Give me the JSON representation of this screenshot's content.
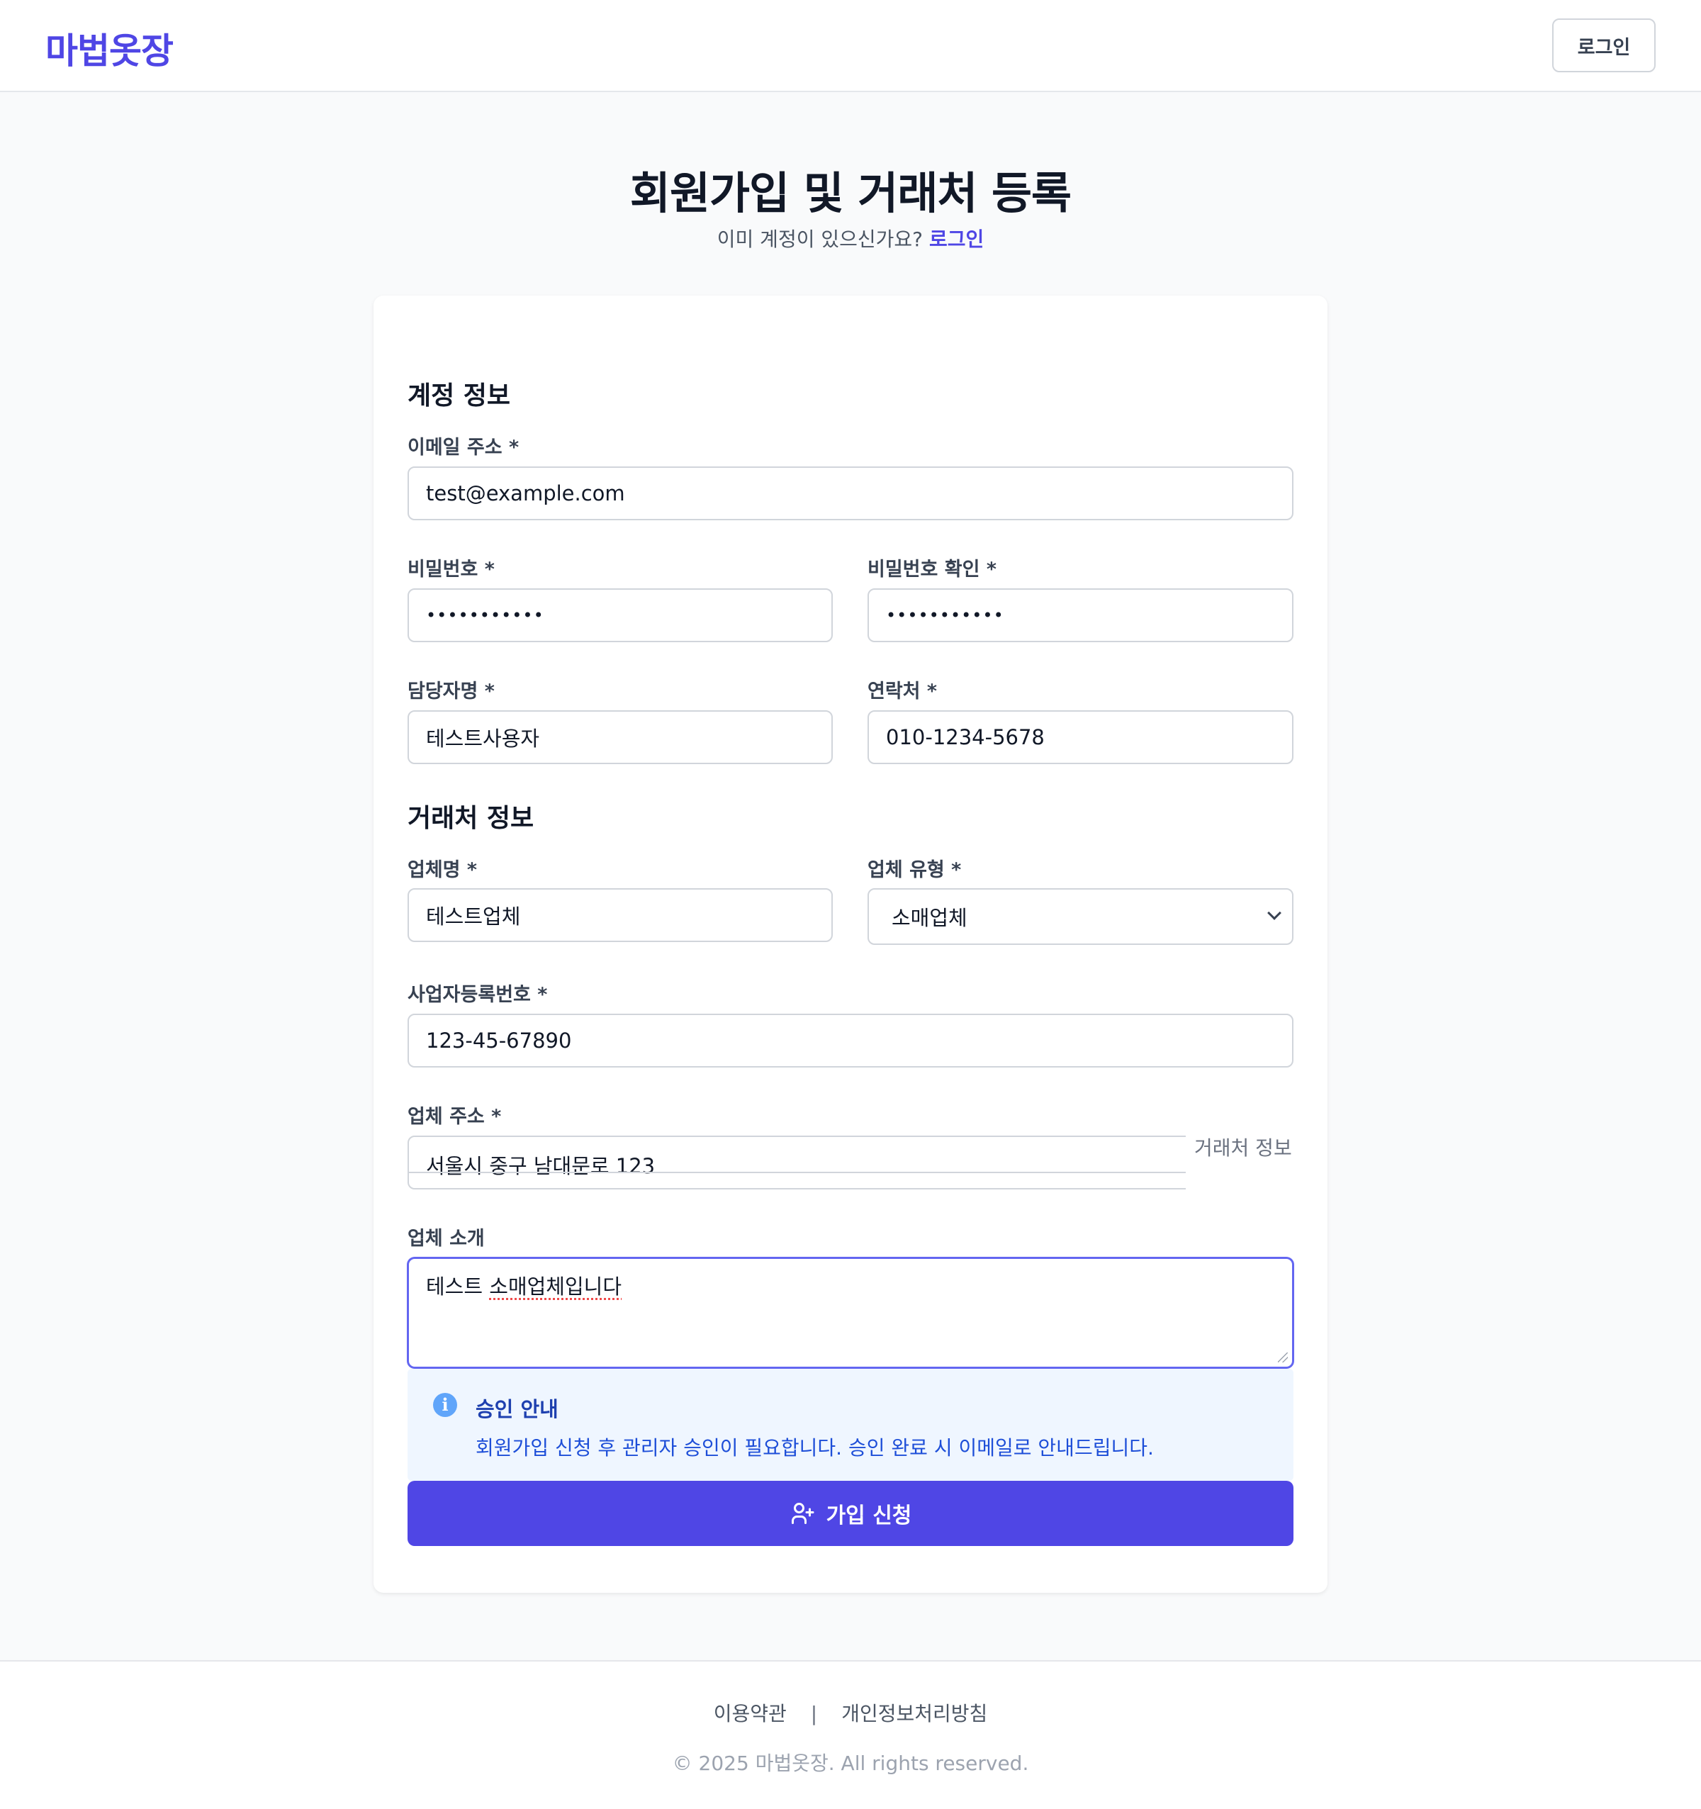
{
  "header": {
    "logo": "마법옷장",
    "login_button": "로그인"
  },
  "page": {
    "title": "회원가입 및 거래처 등록",
    "subtitle_text": "이미 계정이 있으신가요?",
    "subtitle_link": "로그인"
  },
  "account_section": {
    "title": "계정 정보",
    "email": {
      "label": "이메일 주소 *",
      "value": "test@example.com"
    },
    "password": {
      "label": "비밀번호 *",
      "value": "•••••••••••"
    },
    "password_confirm": {
      "label": "비밀번호 확인 *",
      "value": "•••••••••••"
    },
    "manager": {
      "label": "담당자명 *",
      "value": "테스트사용자"
    },
    "phone": {
      "label": "연락처 *",
      "value": "010-1234-5678"
    }
  },
  "business_section": {
    "title": "거래처 정보",
    "company_name": {
      "label": "업체명 *",
      "value": "테스트업체"
    },
    "company_type": {
      "label": "업체 유형 *",
      "value": "소매업체"
    },
    "business_number": {
      "label": "사업자등록번호 *",
      "value": "123-45-67890"
    },
    "address": {
      "label": "업체 주소 *",
      "value": "서울시 중구 남대문로 123",
      "overlay": "거래처 정보"
    },
    "intro": {
      "label": "업체 소개",
      "value_plain": "테스트 ",
      "value_spell": "소매업체입니다"
    }
  },
  "notice": {
    "title": "승인 안내",
    "text": "회원가입 신청 후 관리자 승인이 필요합니다. 승인 완료 시 이메일로 안내드립니다."
  },
  "submit_button": "가입 신청",
  "footer": {
    "terms": "이용약관",
    "separator": "|",
    "privacy": "개인정보처리방침",
    "copyright": "© 2025 마법옷장. All rights reserved."
  },
  "colors": {
    "brand": "#4f46e5",
    "notice_bg": "#eff6ff",
    "notice_text": "#1d4ed8"
  }
}
